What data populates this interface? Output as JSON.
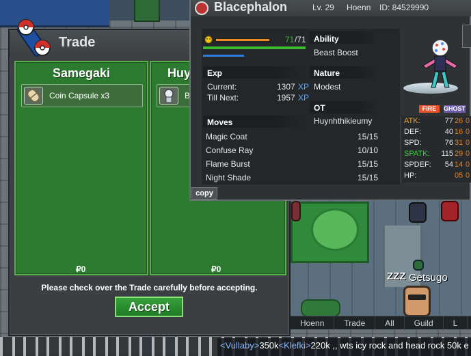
{
  "trade": {
    "title": "Trade",
    "left_player": {
      "name": "Samegaki",
      "item_label": "Coin Capsule  x3",
      "money": "₽0"
    },
    "right_player": {
      "name": "Huy",
      "item_label": "B",
      "money": "₽0"
    },
    "notice": "Please check over the Trade carefully before accepting.",
    "accept_label": "Accept"
  },
  "pokemon": {
    "name": "Blacephalon",
    "level": "Lv. 29",
    "region": "Hoenn",
    "id": "ID: 84529990",
    "hp_current": "71",
    "hp_max": "/71",
    "hp_fraction": 1.0,
    "exp": {
      "label": "Exp",
      "current_label": "Current:",
      "current_value": "1307",
      "till_next_label": "Till Next:",
      "till_next_value": "1957",
      "unit": "XP"
    },
    "ability_label": "Ability",
    "ability": "Beast Boost",
    "nature_label": "Nature",
    "nature": "Modest",
    "ot_label": "OT",
    "ot": "Huynhthikieumy",
    "moves_label": "Moves",
    "moves": [
      {
        "name": "Magic Coat",
        "pp": "15/15"
      },
      {
        "name": "Confuse Ray",
        "pp": "10/10"
      },
      {
        "name": "Flame Burst",
        "pp": "15/15"
      },
      {
        "name": "Night Shade",
        "pp": "15/15"
      }
    ],
    "types": [
      "FIRE",
      "GHOST"
    ],
    "stats": [
      {
        "name": "ATK:",
        "value": "77",
        "iv": "26",
        "ev": "0",
        "color": "#f0a030"
      },
      {
        "name": "DEF:",
        "value": "40",
        "iv": "16",
        "ev": "0",
        "color": "#e6e9ec"
      },
      {
        "name": "SPD:",
        "value": "76",
        "iv": "31",
        "ev": "0",
        "color": "#e6e9ec"
      },
      {
        "name": "SPATK:",
        "value": "115",
        "iv": "29",
        "ev": "0",
        "color": "#39d438"
      },
      {
        "name": "SPDEF:",
        "value": "54",
        "iv": "14",
        "ev": "0",
        "color": "#e6e9ec"
      },
      {
        "name": "HP:",
        "value": "",
        "iv": "05",
        "ev": "0",
        "color": "#e6e9ec"
      }
    ],
    "copy_label": "copy"
  },
  "world": {
    "player_name": "Getsugo",
    "sleep_icon": "ZZZ"
  },
  "chat": {
    "tabs": [
      "Hoenn",
      "Trade",
      "All",
      "Guild",
      "L"
    ],
    "messages": [
      {
        "name": "<Vullaby>",
        "text": "350k"
      },
      {
        "name": "<Klefki>",
        "text": "220k ,, wts icy rock and head rock 50k e"
      }
    ]
  },
  "colors": {
    "panel_green": "#2c7a30",
    "accept_green": "#1f7a24",
    "xp_blue": "#5aa9ff",
    "fire_type": "#e8522a",
    "ghost_type": "#6a5aa8"
  }
}
